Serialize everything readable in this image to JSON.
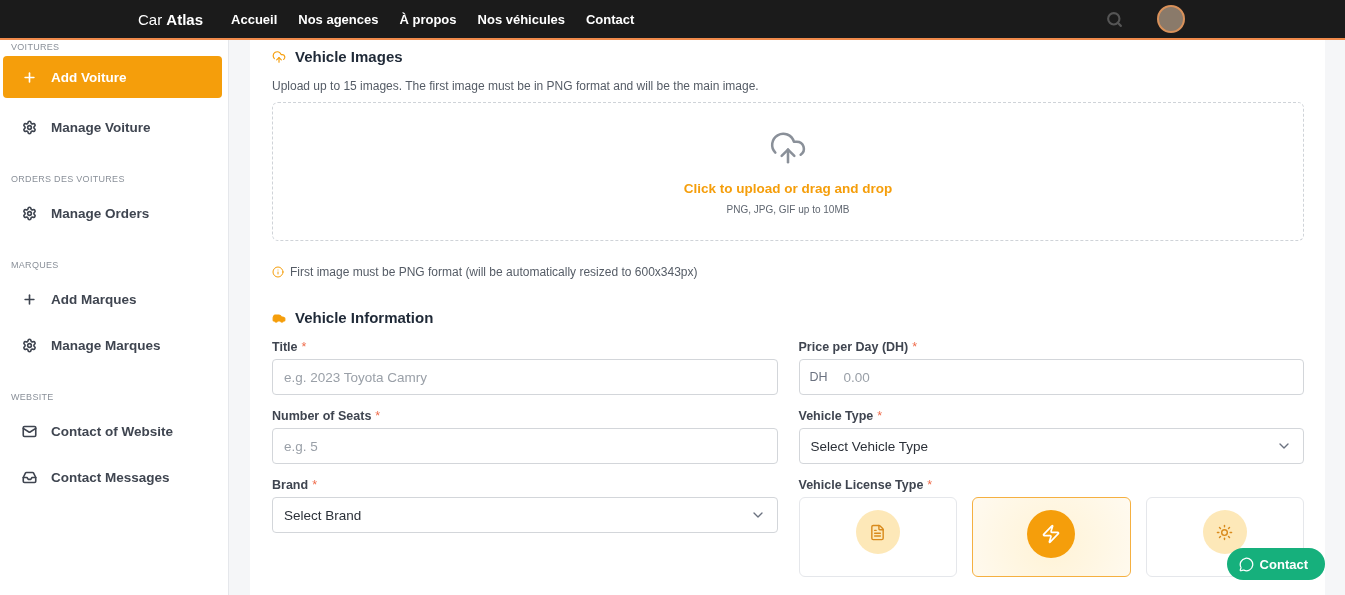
{
  "navbar": {
    "brand": "Car",
    "brand_bold": "Atlas",
    "links": [
      "Accueil",
      "Nos agences",
      "À propos",
      "Nos véhicules",
      "Contact"
    ]
  },
  "sidebar": {
    "sections": [
      {
        "title": "VOITURES",
        "items": [
          {
            "label": "Add Voiture",
            "kind": "add",
            "selected": true
          },
          {
            "label": "Manage Voiture",
            "kind": "manage",
            "selected": false
          }
        ]
      },
      {
        "title": "ORDERS DES VOITURES",
        "items": [
          {
            "label": "Manage Orders",
            "kind": "manage",
            "selected": false
          }
        ]
      },
      {
        "title": "MARQUES",
        "items": [
          {
            "label": "Add Marques",
            "kind": "add",
            "selected": false
          },
          {
            "label": "Manage Marques",
            "kind": "manage",
            "selected": false
          }
        ]
      },
      {
        "title": "WEBSITE",
        "items": [
          {
            "label": "Contact of Website",
            "kind": "mail",
            "selected": false
          },
          {
            "label": "Contact Messages",
            "kind": "inbox",
            "selected": false
          }
        ]
      }
    ]
  },
  "images_section": {
    "title": "Vehicle Images",
    "description": "Upload up to 15 images. The first image must be in PNG format and will be the main image.",
    "dropzone": {
      "action": "Click to upload or drag and drop",
      "hint": "PNG, JPG, GIF up to 10MB"
    },
    "note": "First image must be PNG format (will be automatically resized to 600x343px)"
  },
  "info_section": {
    "title": "Vehicle Information",
    "fields": [
      {
        "label": "Title",
        "marker": "*",
        "kind": "text",
        "placeholder": "e.g. 2023 Toyota Camry"
      },
      {
        "label": "Price per Day (DH)",
        "marker": "*",
        "kind": "prefix",
        "prefix": "DH",
        "placeholder": "0.00"
      },
      {
        "label": "Number of Seats",
        "marker": "*",
        "kind": "text",
        "placeholder": "e.g. 5"
      },
      {
        "label": "Vehicle Type",
        "marker": "*",
        "kind": "select",
        "value": "Select Vehicle Type"
      },
      {
        "label": "Brand",
        "marker": "*",
        "kind": "select",
        "value": "Select Brand"
      },
      {
        "label": "Vehicle License Type",
        "marker": "*",
        "kind": "cards",
        "options": [
          {
            "selected": false
          },
          {
            "selected": true
          },
          {
            "selected": false
          }
        ]
      }
    ]
  },
  "contact_button": {
    "label": "Contact"
  }
}
